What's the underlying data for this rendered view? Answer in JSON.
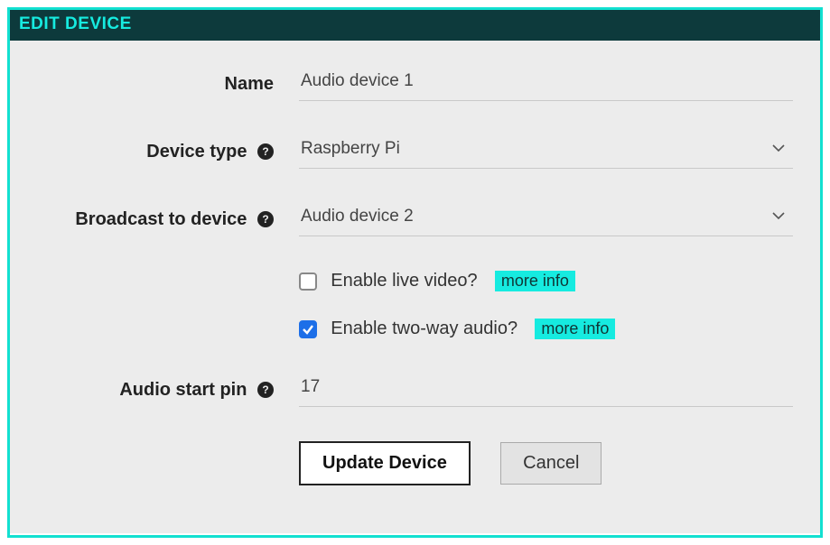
{
  "panel": {
    "title": "EDIT DEVICE"
  },
  "labels": {
    "name": "Name",
    "device_type": "Device type",
    "broadcast": "Broadcast to device",
    "audio_pin": "Audio start pin"
  },
  "fields": {
    "name_value": "Audio device 1",
    "device_type_value": "Raspberry Pi",
    "broadcast_value": "Audio device 2",
    "audio_pin_value": "17"
  },
  "checkboxes": {
    "live_video_label": "Enable live video?",
    "live_video_checked": false,
    "two_way_audio_label": "Enable two-way audio?",
    "two_way_audio_checked": true,
    "more_info": "more info"
  },
  "buttons": {
    "update": "Update Device",
    "cancel": "Cancel"
  }
}
